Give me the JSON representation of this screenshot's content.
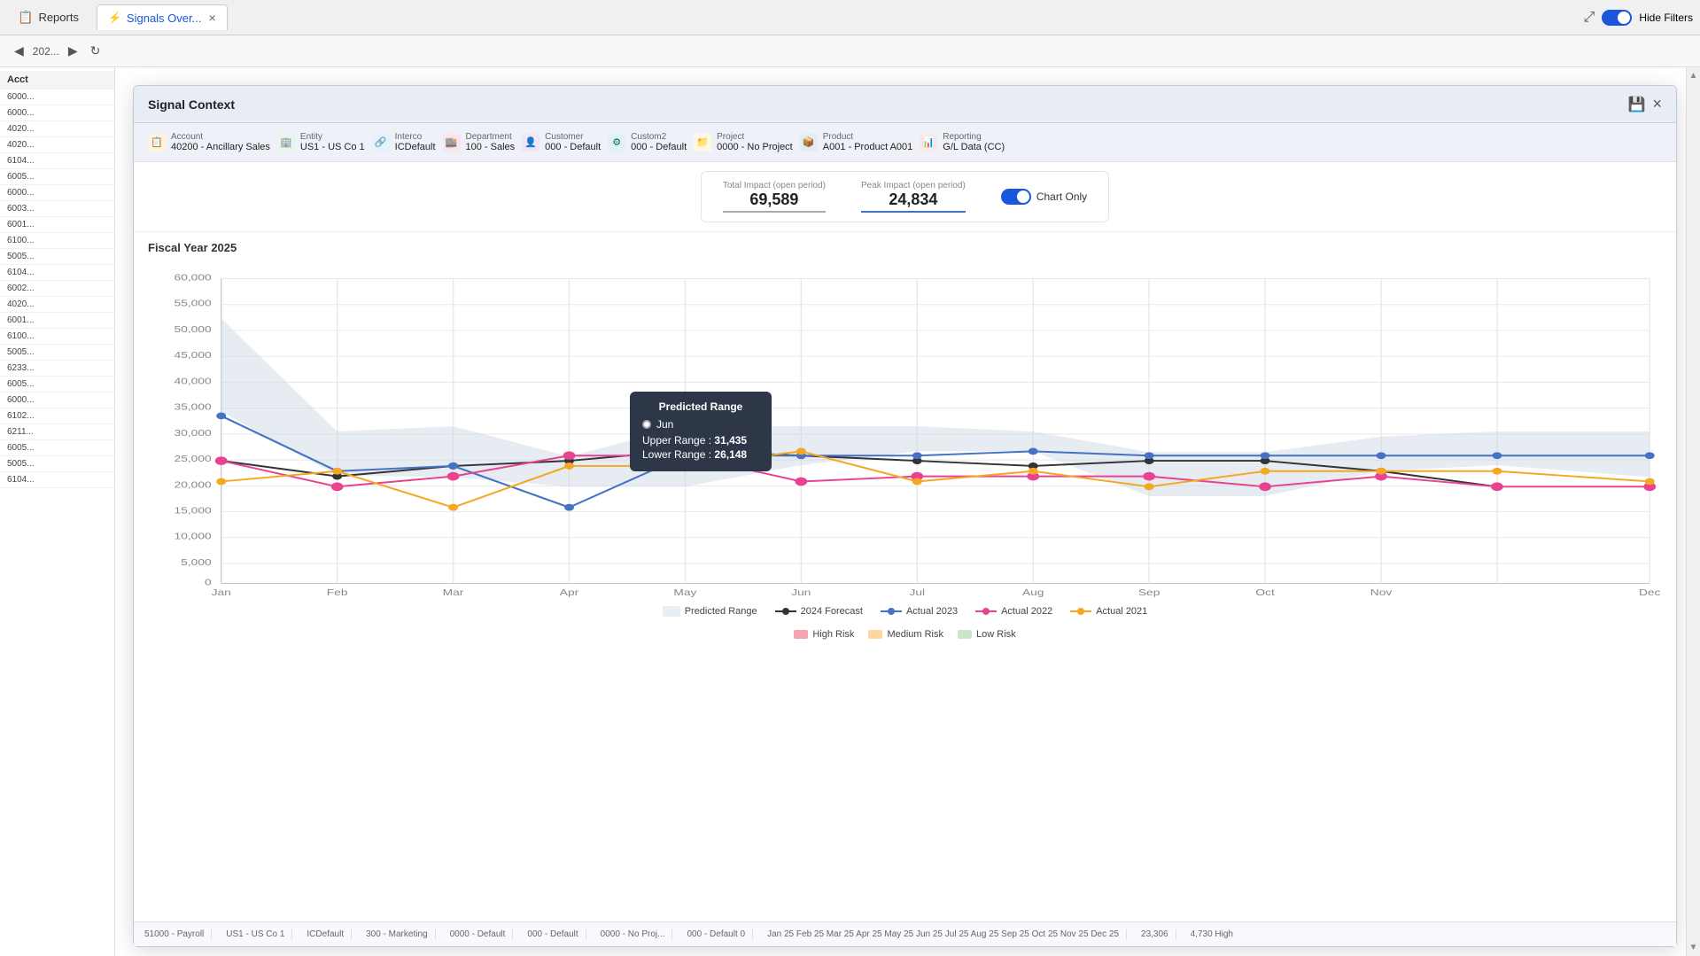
{
  "tabs": {
    "reports_label": "Reports",
    "signals_label": "Signals Over...",
    "close_label": "×"
  },
  "top_bar": {
    "expand_icon": "⤢",
    "hide_filters_label": "Hide Filters"
  },
  "second_bar": {
    "year": "202..."
  },
  "modal": {
    "title": "Signal Context",
    "save_icon": "💾",
    "close_icon": "×"
  },
  "filters": [
    {
      "id": "account",
      "label": "Account",
      "value": "40200 - Ancillary Sales",
      "icon_class": "filter-icon-acct",
      "icon": "📋"
    },
    {
      "id": "entity",
      "label": "Entity",
      "value": "US1 - US Co 1",
      "icon_class": "filter-icon-entity",
      "icon": "🏢"
    },
    {
      "id": "interco",
      "label": "Interco",
      "value": "ICDefault",
      "icon_class": "filter-icon-interco",
      "icon": "🔗"
    },
    {
      "id": "department",
      "label": "Department",
      "value": "100 - Sales",
      "icon_class": "filter-icon-dept",
      "icon": "🏬"
    },
    {
      "id": "customer",
      "label": "Customer",
      "value": "000 - Default",
      "icon_class": "filter-icon-cust",
      "icon": "👤"
    },
    {
      "id": "custom2",
      "label": "Custom2",
      "value": "000 - Default",
      "icon_class": "filter-icon-custom2",
      "icon": "⚙"
    },
    {
      "id": "project",
      "label": "Project",
      "value": "0000 - No Project",
      "icon_class": "filter-icon-project",
      "icon": "📁"
    },
    {
      "id": "product",
      "label": "Product",
      "value": "A001 - Product A001",
      "icon_class": "filter-icon-product",
      "icon": "📦"
    },
    {
      "id": "reporting",
      "label": "Reporting",
      "value": "G/L Data (CC)",
      "icon_class": "filter-icon-reporting",
      "icon": "📊"
    }
  ],
  "stats": {
    "total_label": "Total Impact (open period)",
    "total_value": "69,589",
    "peak_label": "Peak Impact (open period)",
    "peak_value": "24,834",
    "chart_only_label": "Chart Only"
  },
  "chart": {
    "title": "Fiscal Year 2025",
    "y_labels": [
      "60,000",
      "55,000",
      "50,000",
      "45,000",
      "40,000",
      "35,000",
      "30,000",
      "25,000",
      "20,000",
      "15,000",
      "10,000",
      "5,000",
      "0"
    ],
    "x_labels": [
      "Jan",
      "Feb",
      "Mar",
      "Apr",
      "May",
      "Jun",
      "Jul",
      "Aug",
      "Sep",
      "Oct",
      "Nov",
      "Dec"
    ],
    "legend": [
      {
        "id": "predicted_range",
        "label": "Predicted Range",
        "type": "area",
        "color": "#c0c8d0"
      },
      {
        "id": "forecast_2024",
        "label": "2024 Forecast",
        "type": "line",
        "color": "#444"
      },
      {
        "id": "actual_2023",
        "label": "Actual 2023",
        "type": "line",
        "color": "#4472c4"
      },
      {
        "id": "actual_2022",
        "label": "Actual 2022",
        "type": "line",
        "color": "#e84393"
      },
      {
        "id": "actual_2021",
        "label": "Actual 2021",
        "type": "line",
        "color": "#f5a623"
      }
    ]
  },
  "tooltip": {
    "title": "Predicted Range",
    "month": "Jun",
    "upper_range_label": "Upper Range",
    "upper_range_value": "31,435",
    "lower_range_label": "Lower Range",
    "lower_range_value": "26,148"
  },
  "risk_legend": [
    {
      "id": "high_risk",
      "label": "High Risk",
      "color": "#f4a5b0"
    },
    {
      "id": "medium_risk",
      "label": "Medium Risk",
      "color": "#ffd5a0"
    },
    {
      "id": "low_risk",
      "label": "Low Risk",
      "color": "#c8e6c9"
    }
  ],
  "bottom_row": {
    "items": [
      "51000 - Payroll",
      "US1 - US Co 1",
      "ICDefault",
      "300 - Marketing",
      "0000 - Default",
      "000 - Default",
      "0000 - No Proj...",
      "000 - Default 0",
      "Jan 25 Feb 25 Mar 25 Apr 25 May 25 Jun 25 Jul 25 Aug 25 Sep 25 Oct 25 Nov 25 Dec 25",
      "23,306",
      "4,730 High"
    ]
  },
  "left_panel": {
    "header": "Acct",
    "rows": [
      "6000...",
      "6000...",
      "4020...",
      "4020...",
      "6104...",
      "6005...",
      "6000...",
      "6003...",
      "6001...",
      "6100...",
      "5005...",
      "6104...",
      "6002...",
      "4020...",
      "6001...",
      "6100...",
      "5005...",
      "6233...",
      "6005...",
      "6000...",
      "6102...",
      "6211...",
      "6005...",
      "5005...",
      "6104..."
    ]
  }
}
